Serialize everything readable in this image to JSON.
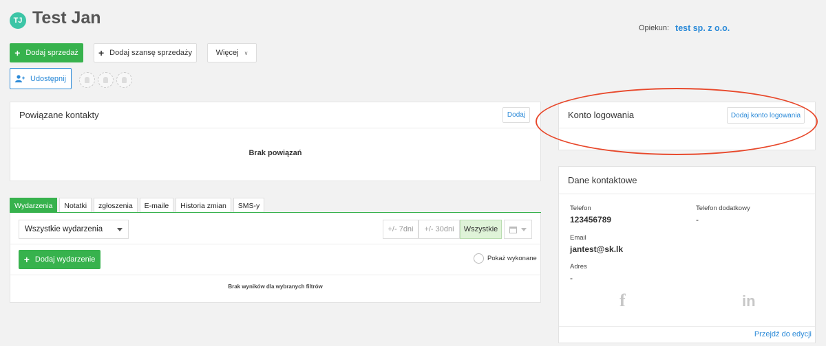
{
  "header": {
    "avatar_initials": "TJ",
    "title": "Test Jan",
    "opiekun_label": "Opiekun:",
    "opiekun_value": "test sp. z o.o."
  },
  "actions": {
    "add_sale": "Dodaj sprzedaż",
    "add_opportunity": "Dodaj szansę sprzedaży",
    "more": "Więcej",
    "share": "Udostępnij"
  },
  "related_contacts": {
    "title": "Powiązane kontakty",
    "add_label": "Dodaj",
    "empty_text": "Brak powiązań"
  },
  "login_account": {
    "title": "Konto logowania",
    "add_label": "Dodaj konto logowania"
  },
  "tabs": [
    "Wydarzenia",
    "Notatki",
    "zgłoszenia",
    "E-maile",
    "Historia zmian",
    "SMS-y"
  ],
  "events": {
    "filter_selected": "Wszystkie wydarzenia",
    "range_7": "+/- 7dni",
    "range_30": "+/- 30dni",
    "range_all": "Wszystkie",
    "add_event": "Dodaj wydarzenie",
    "show_done": "Pokaż wykonane",
    "empty_text": "Brak wyników dla wybranych filtrów"
  },
  "contact_details": {
    "title": "Dane kontaktowe",
    "phone_label": "Telefon",
    "phone_value": "123456789",
    "phone2_label": "Telefon dodatkowy",
    "phone2_value": "-",
    "email_label": "Email",
    "email_value": "jantest@sk.lk",
    "address_label": "Adres",
    "address_value": "-",
    "facebook_glyph": "f",
    "linkedin_glyph": "in",
    "edit_link": "Przejdź do edycji"
  },
  "colors": {
    "green": "#37b24d",
    "blue": "#2b8ad8",
    "annotation_red": "#e8492c",
    "avatar": "#3cc5a6"
  }
}
